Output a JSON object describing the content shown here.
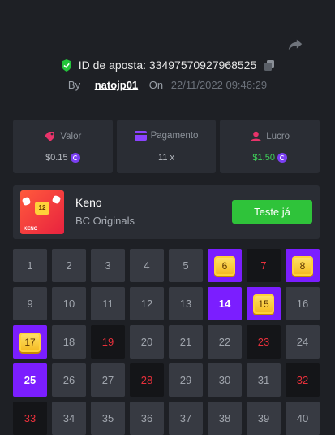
{
  "header": {
    "bet_id_label": "ID de aposta:",
    "bet_id": "33497570927968525",
    "by_label": "By",
    "username": "natojp01",
    "on_label": "On",
    "date": "22/11/2022 09:46:29"
  },
  "stats": {
    "valor": {
      "label": "Valor",
      "value": "$0.15",
      "icon": "tag-icon"
    },
    "pagamento": {
      "label": "Pagamento",
      "value": "11 x",
      "icon": "card-icon"
    },
    "lucro": {
      "label": "Lucro",
      "value": "$1.50",
      "icon": "profit-icon"
    }
  },
  "game": {
    "title": "Keno",
    "provider": "BC Originals",
    "button": "Teste já",
    "thumb_label": "KENO",
    "thumb_number": "12"
  },
  "grid": {
    "cells": [
      {
        "n": "1",
        "s": "normal"
      },
      {
        "n": "2",
        "s": "normal"
      },
      {
        "n": "3",
        "s": "normal"
      },
      {
        "n": "4",
        "s": "normal"
      },
      {
        "n": "5",
        "s": "normal"
      },
      {
        "n": "6",
        "s": "match"
      },
      {
        "n": "7",
        "s": "miss"
      },
      {
        "n": "8",
        "s": "match"
      },
      {
        "n": "9",
        "s": "normal"
      },
      {
        "n": "10",
        "s": "normal"
      },
      {
        "n": "11",
        "s": "normal"
      },
      {
        "n": "12",
        "s": "normal"
      },
      {
        "n": "13",
        "s": "normal"
      },
      {
        "n": "14",
        "s": "hit"
      },
      {
        "n": "15",
        "s": "match"
      },
      {
        "n": "16",
        "s": "normal"
      },
      {
        "n": "17",
        "s": "match"
      },
      {
        "n": "18",
        "s": "normal"
      },
      {
        "n": "19",
        "s": "miss"
      },
      {
        "n": "20",
        "s": "normal"
      },
      {
        "n": "21",
        "s": "normal"
      },
      {
        "n": "22",
        "s": "normal"
      },
      {
        "n": "23",
        "s": "miss"
      },
      {
        "n": "24",
        "s": "normal"
      },
      {
        "n": "25",
        "s": "hit"
      },
      {
        "n": "26",
        "s": "normal"
      },
      {
        "n": "27",
        "s": "normal"
      },
      {
        "n": "28",
        "s": "miss"
      },
      {
        "n": "29",
        "s": "normal"
      },
      {
        "n": "30",
        "s": "normal"
      },
      {
        "n": "31",
        "s": "normal"
      },
      {
        "n": "32",
        "s": "miss"
      },
      {
        "n": "33",
        "s": "miss"
      },
      {
        "n": "34",
        "s": "normal"
      },
      {
        "n": "35",
        "s": "normal"
      },
      {
        "n": "36",
        "s": "normal"
      },
      {
        "n": "37",
        "s": "normal"
      },
      {
        "n": "38",
        "s": "normal"
      },
      {
        "n": "39",
        "s": "normal"
      },
      {
        "n": "40",
        "s": "normal"
      }
    ]
  },
  "colors": {
    "accent_purple": "#7b1eff",
    "green": "#2fc33a",
    "miss_red": "#e8303b",
    "gem_gold": "#ffd23a"
  }
}
